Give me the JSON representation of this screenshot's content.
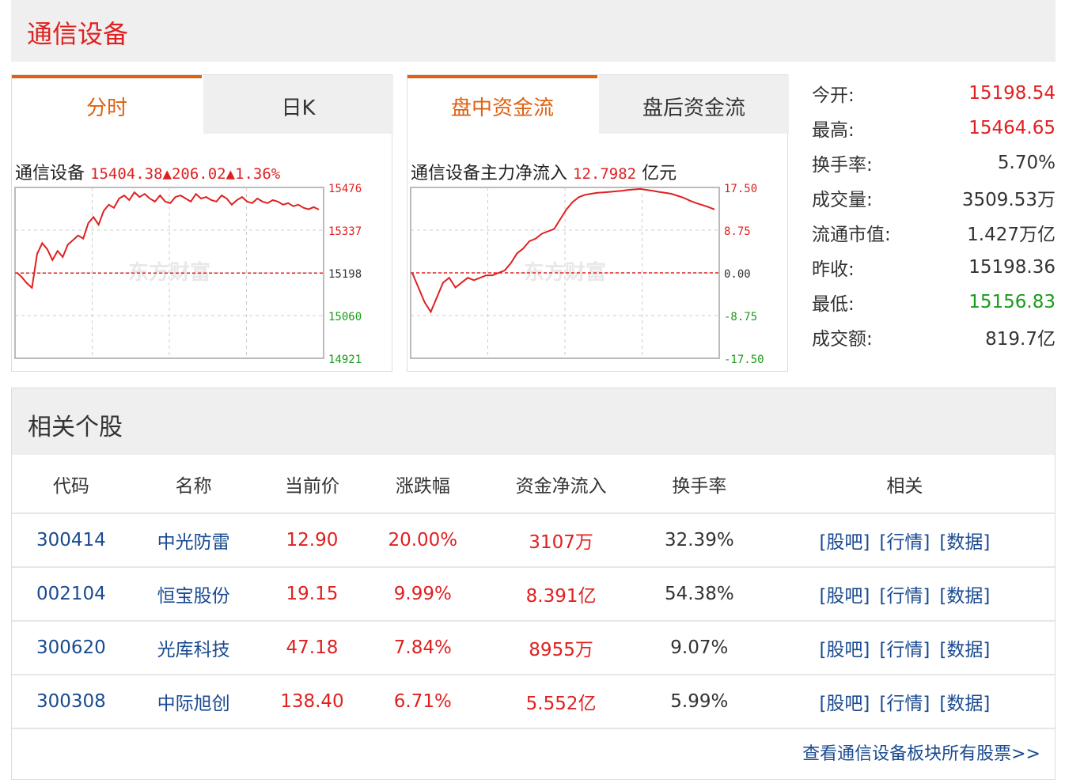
{
  "title": "通信设备",
  "left_panel": {
    "tabs": [
      {
        "label": "分时"
      },
      {
        "label": "日K"
      }
    ],
    "chart_name": "通信设备",
    "chart_value": "15404.38▲206.02▲1.36%",
    "watermark": "东方财富",
    "y_ticks": [
      "15476",
      "15337",
      "15198",
      "15060",
      "14921"
    ]
  },
  "right_panel": {
    "tabs": [
      {
        "label": "盘中资金流"
      },
      {
        "label": "盘后资金流"
      }
    ],
    "chart_name": "通信设备主力净流入",
    "chart_value": "12.7982",
    "chart_unit": "亿元",
    "watermark": "东方财富",
    "y_ticks": [
      "17.50",
      "8.75",
      "0.00",
      "-8.75",
      "-17.50"
    ]
  },
  "stats": [
    {
      "label": "今开:",
      "value": "15198.54",
      "tone": "up"
    },
    {
      "label": "最高:",
      "value": "15464.65",
      "tone": "up"
    },
    {
      "label": "换手率:",
      "value": "5.70%",
      "tone": "plain"
    },
    {
      "label": "成交量:",
      "value": "3509.53万",
      "tone": "plain"
    },
    {
      "label": "流通市值:",
      "value": "1.427万亿",
      "tone": "plain"
    },
    {
      "label": "昨收:",
      "value": "15198.36",
      "tone": "plain"
    },
    {
      "label": "最低:",
      "value": "15156.83",
      "tone": "down"
    },
    {
      "label": "成交额:",
      "value": "819.7亿",
      "tone": "plain"
    }
  ],
  "related": {
    "heading": "相关个股",
    "columns": [
      "代码",
      "名称",
      "当前价",
      "涨跌幅",
      "资金净流入",
      "换手率",
      "相关"
    ],
    "rows": [
      {
        "code": "300414",
        "name": "中光防雷",
        "price": "12.90",
        "change": "20.00%",
        "inflow": "3107万",
        "turnover": "32.39%"
      },
      {
        "code": "002104",
        "name": "恒宝股份",
        "price": "19.15",
        "change": "9.99%",
        "inflow": "8.391亿",
        "turnover": "54.38%"
      },
      {
        "code": "300620",
        "name": "光库科技",
        "price": "47.18",
        "change": "7.84%",
        "inflow": "8955万",
        "turnover": "9.07%"
      },
      {
        "code": "300308",
        "name": "中际旭创",
        "price": "138.40",
        "change": "6.71%",
        "inflow": "5.552亿",
        "turnover": "5.99%"
      }
    ],
    "links": [
      "[股吧]",
      "[行情]",
      "[数据]"
    ],
    "more_label": "查看通信设备板块所有股票>>"
  },
  "colors": {
    "up": "#e02020",
    "down": "#1a9a1a",
    "accent": "#e06010",
    "link": "#1a4a90"
  },
  "chart_data": [
    {
      "type": "line",
      "title": "通信设备",
      "ylim": [
        14921,
        15476
      ],
      "baseline": 15198,
      "series": [
        {
          "values": [
            15200,
            15185,
            15165,
            15150,
            15260,
            15295,
            15275,
            15240,
            15270,
            15250,
            15290,
            15305,
            15320,
            15310,
            15360,
            15380,
            15355,
            15400,
            15420,
            15410,
            15440,
            15450,
            15435,
            15460,
            15445,
            15455,
            15440,
            15430,
            15450,
            15430,
            15425,
            15445,
            15450,
            15440,
            15430,
            15455,
            15440,
            15445,
            15435,
            15430,
            15450,
            15440,
            15420,
            15435,
            15445,
            15430,
            15425,
            15440,
            15430,
            15425,
            15435,
            15430,
            15420,
            15425,
            15415,
            15420,
            15410,
            15405,
            15412,
            15404
          ]
        }
      ]
    },
    {
      "type": "line",
      "title": "通信设备主力净流入",
      "ylim": [
        -17.5,
        17.5
      ],
      "baseline": 0,
      "series": [
        {
          "values": [
            0,
            -3,
            -6,
            -8,
            -5,
            -2,
            -1,
            -3,
            -2,
            -1,
            -1.5,
            -1,
            -0.5,
            -0.5,
            0,
            0.5,
            2,
            4,
            5,
            6.5,
            7,
            8,
            8.5,
            9,
            11,
            13,
            14.5,
            15.5,
            16,
            16.2,
            16.4,
            16.5,
            16.6,
            16.7,
            16.8,
            17,
            17.1,
            17.2,
            17,
            16.8,
            16.6,
            16.4,
            16.2,
            15.8,
            15.4,
            14.8,
            14.3,
            13.9,
            13.5,
            13
          ]
        }
      ]
    }
  ]
}
